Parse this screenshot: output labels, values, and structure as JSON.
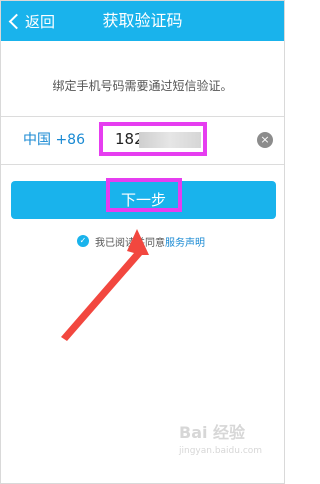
{
  "header": {
    "back_label": "返回",
    "title": "获取验证码"
  },
  "main": {
    "instruction": "绑定手机号码需要通过短信验证。",
    "country_code": "中国 +86",
    "phone_value": "182",
    "clear_icon": "×",
    "next_button_label": "下一步",
    "agreement_prefix": "我已阅读并同意",
    "agreement_link": "服务声明"
  },
  "watermark": {
    "line1": "Bai 经验",
    "line2": "jingyan.baidu.com"
  },
  "colors": {
    "accent": "#19b3ec",
    "link": "#1a8ad3",
    "highlight": "#e63df0",
    "arrow": "#f2473f"
  },
  "icons": [
    "back-chevron-icon",
    "clear-icon",
    "check-icon",
    "arrow-annotation-icon"
  ]
}
